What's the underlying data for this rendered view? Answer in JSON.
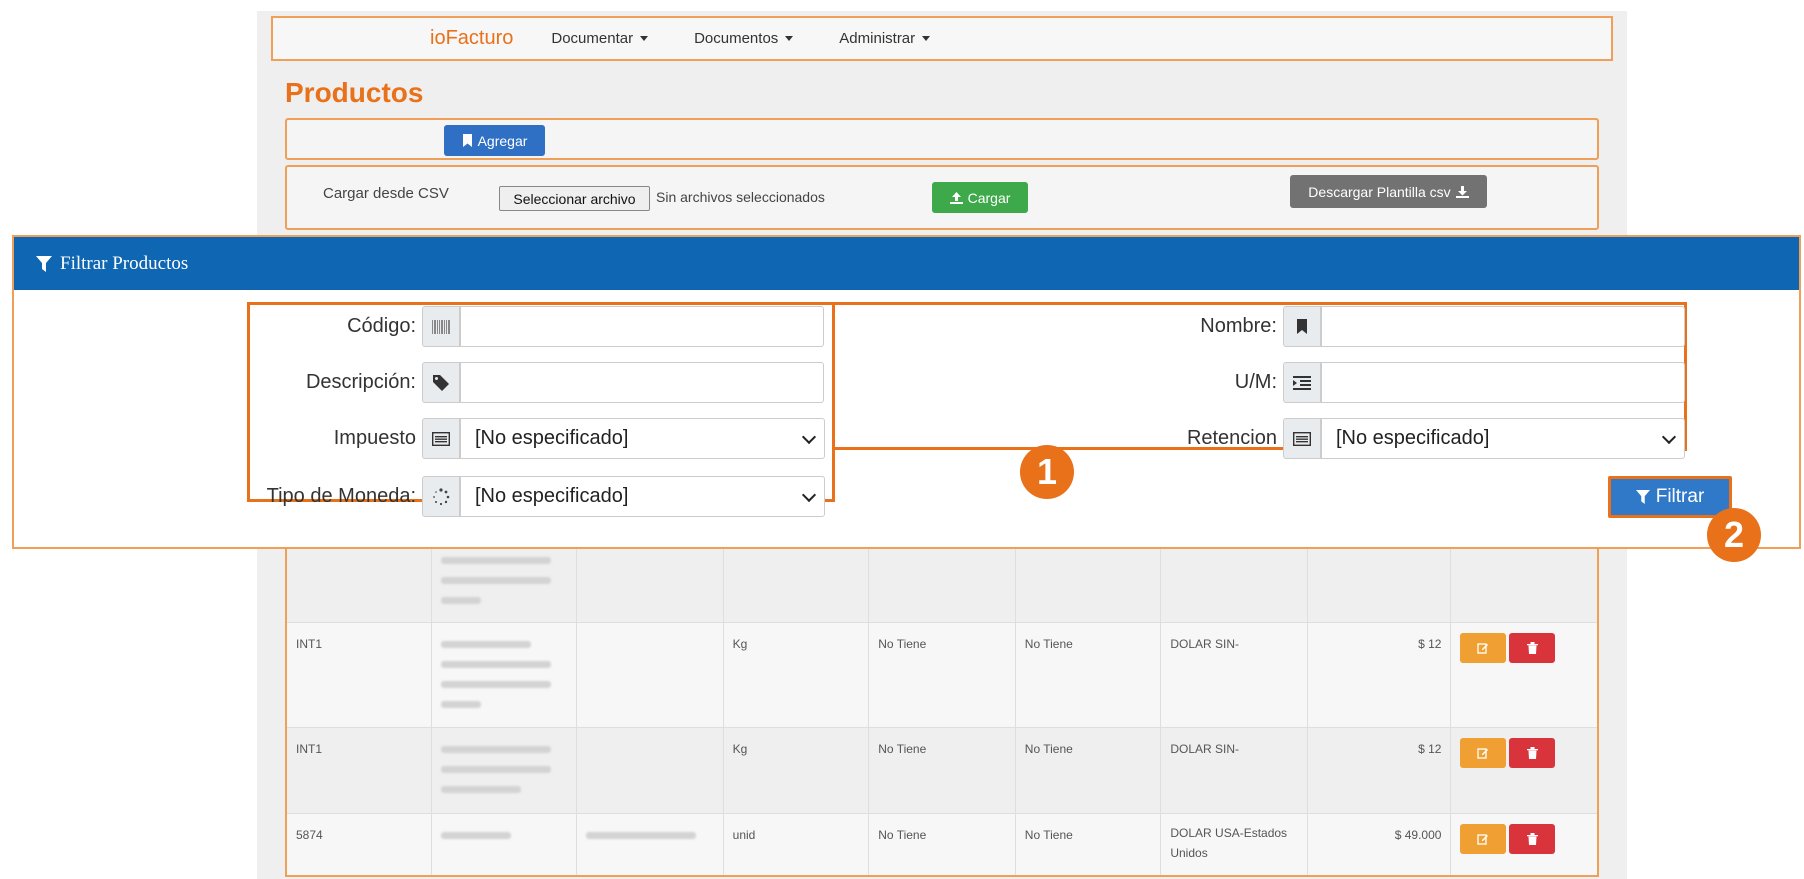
{
  "navbar": {
    "brand": "ioFacturo",
    "menu": [
      "Documentar",
      "Documentos",
      "Administrar"
    ]
  },
  "page": {
    "title": "Productos"
  },
  "actions": {
    "add_label": "Agregar"
  },
  "csv": {
    "label": "Cargar desde CSV",
    "file_button": "Seleccionar archivo",
    "file_status": "Sin archivos seleccionados",
    "load_label": "Cargar",
    "template_label": "Descargar Plantilla csv"
  },
  "filter": {
    "title": "Filtrar Productos",
    "fields": {
      "codigo": {
        "label": "Código:",
        "value": ""
      },
      "nombre": {
        "label": "Nombre:",
        "value": ""
      },
      "descripcion": {
        "label": "Descripción:",
        "value": ""
      },
      "um": {
        "label": "U/M:",
        "value": ""
      },
      "impuesto": {
        "label": "Impuesto",
        "value": "[No especificado]"
      },
      "retencion": {
        "label": "Retencion",
        "value": "[No especificado]"
      },
      "moneda": {
        "label": "Tipo de Moneda:",
        "value": "[No especificado]"
      }
    },
    "submit_label": "Filtrar",
    "callouts": [
      "1",
      "2"
    ]
  },
  "table": {
    "rows": [
      {
        "codigo": "INT1",
        "um": "Kg",
        "impuesto": "No Tiene",
        "retencion": "No Tiene",
        "moneda": "DOLAR SIN-",
        "precio": "$ 12"
      },
      {
        "codigo": "INT1",
        "um": "Kg",
        "impuesto": "No Tiene",
        "retencion": "No Tiene",
        "moneda": "DOLAR SIN-",
        "precio": "$ 12"
      },
      {
        "codigo": "5874",
        "um": "unid",
        "impuesto": "No Tiene",
        "retencion": "No Tiene",
        "moneda": "DOLAR USA-Estados Unidos",
        "precio": "$ 49.000"
      }
    ]
  },
  "colors": {
    "accent": "#e8711a",
    "primary": "#2f6fc4",
    "header": "#0f66b2",
    "success": "#3ea94a",
    "warning": "#f0a032",
    "danger": "#d9343c"
  }
}
